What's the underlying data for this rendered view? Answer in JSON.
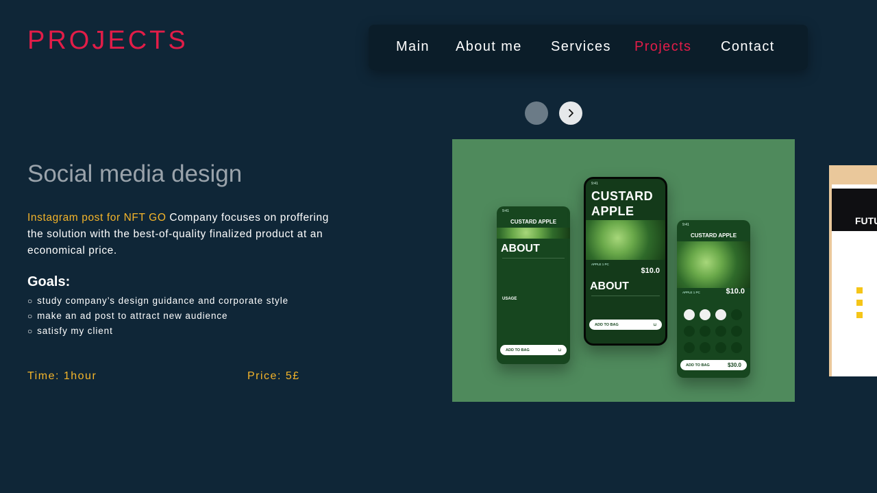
{
  "page_title": "PROJECTS",
  "nav": {
    "items": [
      {
        "label": "Main"
      },
      {
        "label": "About me"
      },
      {
        "label": "Services"
      },
      {
        "label": "Projects"
      },
      {
        "label": "Contact"
      }
    ],
    "active": "Projects"
  },
  "project": {
    "title": "Social media design",
    "desc_highlight": "Instagram post for NFT GO",
    "desc_rest": " Company focuses on proffering the solution with the best-of-quality finalized product at an economical price.",
    "goals_title": "Goals:",
    "goals": [
      "study company’s design guidance and corporate style",
      "make an ad post to attract new audience",
      "satisfy my client"
    ],
    "time": "Time: 1hour",
    "price": "Price: 5£"
  },
  "mockup": {
    "phone_left": {
      "header": "CUSTARD APPLE",
      "heading": "ABOUT",
      "section": "USAGE",
      "button": "ADD TO BAG"
    },
    "phone_center": {
      "title_line1": "CUSTARD",
      "title_line2": "APPLE",
      "price": "$10.0",
      "heading": "ABOUT",
      "button": "ADD TO BAG",
      "item": "APPLE 1 PC"
    },
    "phone_right": {
      "header": "CUSTARD APPLE",
      "price": "$10.0",
      "button": "ADD TO BAG",
      "total": "$30.0",
      "item": "APPLE 1 PC"
    }
  },
  "next_slide": {
    "label": "FUTU"
  },
  "icons": {
    "next": "chevron-right-icon",
    "goal_bullet": "circle-outline-icon"
  },
  "colors": {
    "background": "#0f2637",
    "accent_red": "#e11d48",
    "accent_yellow": "#f5b52a",
    "mockup_bg": "#4f8a5c"
  }
}
